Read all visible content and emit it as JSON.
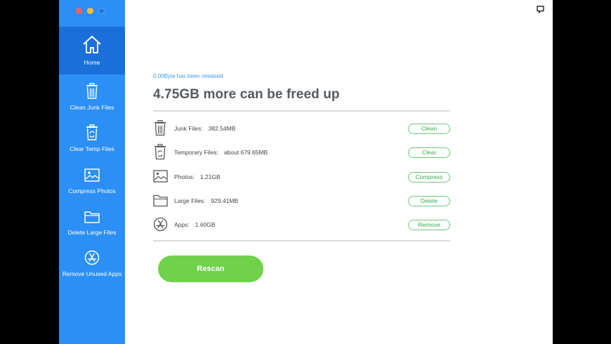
{
  "sidebar": {
    "items": [
      {
        "label": "Home",
        "icon": "home-icon"
      },
      {
        "label": "Clean Junk Files",
        "icon": "trash-icon"
      },
      {
        "label": "Clear Temp Files",
        "icon": "temp-trash-icon"
      },
      {
        "label": "Compress Photos",
        "icon": "photo-icon"
      },
      {
        "label": "Delete Large Files",
        "icon": "folder-icon"
      },
      {
        "label": "Remove Unused Apps",
        "icon": "app-store-icon"
      }
    ],
    "active_index": 0
  },
  "main": {
    "released": "0.00Byte has been released",
    "headline": "4.75GB more can be freed up",
    "rows": [
      {
        "name": "Junk Files:",
        "value": "382.54MB",
        "button": "Clean",
        "icon": "trash-icon"
      },
      {
        "name": "Temporary Files:",
        "value": "about 679.65MB",
        "button": "Clear",
        "icon": "temp-trash-icon"
      },
      {
        "name": "Photos:",
        "value": "1.21GB",
        "button": "Compress",
        "icon": "photo-icon"
      },
      {
        "name": "Large Files:",
        "value": "929.41MB",
        "button": "Delete",
        "icon": "folder-icon"
      },
      {
        "name": "Apps:",
        "value": "1.60GB",
        "button": "Remove",
        "icon": "app-store-icon"
      }
    ],
    "rescan_label": "Rescan"
  },
  "colors": {
    "sidebar": "#2b8ff5",
    "sidebar_active": "#1a6fd8",
    "accent_green": "#6fd24a",
    "button_border": "#6dc779",
    "link_blue": "#3f9be8"
  }
}
